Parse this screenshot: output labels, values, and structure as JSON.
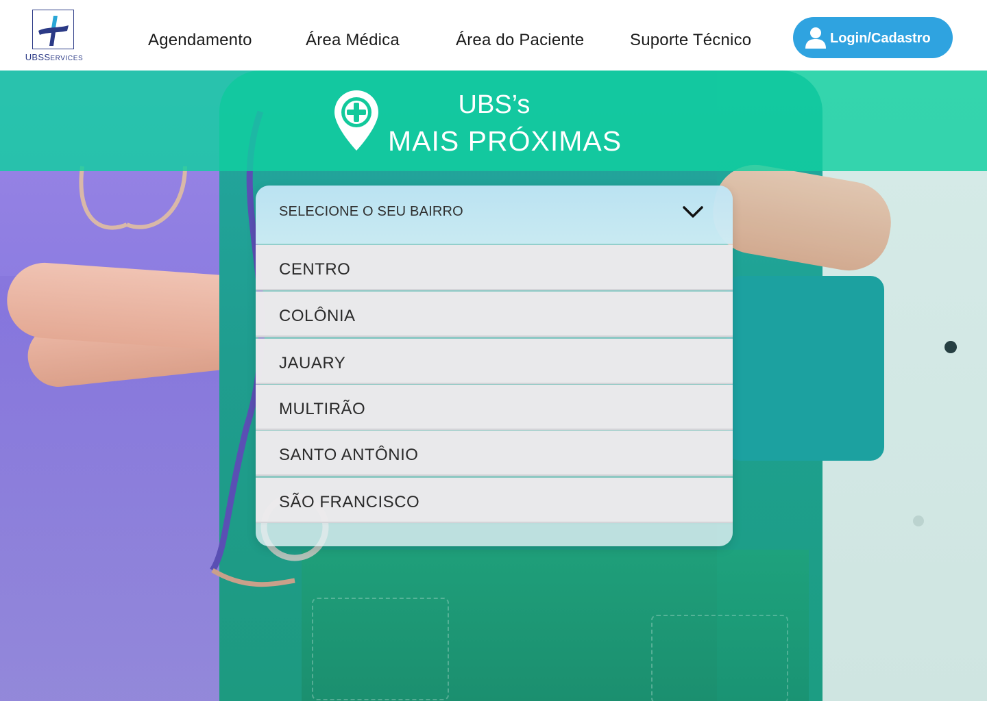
{
  "header": {
    "logo": {
      "text_main": "UBS",
      "text_suffix": "ERVICES",
      "text_s": "S"
    },
    "nav": [
      {
        "label": "Agendamento"
      },
      {
        "label": "Área Médica"
      },
      {
        "label": "Área do Paciente"
      },
      {
        "label": "Suporte Técnico"
      }
    ],
    "login": {
      "label": "Login/Cadastro",
      "icon": "user-icon"
    }
  },
  "banner": {
    "title_line1": "UBS’s",
    "title_line2": "MAIS PRÓXIMAS",
    "icon": "location-pin-plus-icon"
  },
  "dropdown": {
    "placeholder": "SELECIONE O SEU BAIRRO",
    "icon": "chevron-down-icon",
    "options": [
      {
        "label": "CENTRO"
      },
      {
        "label": "COLÔNIA"
      },
      {
        "label": "JAUARY"
      },
      {
        "label": "MULTIRÃO"
      },
      {
        "label": "SANTO ANTÔNIO"
      },
      {
        "label": "SÃO FRANCISCO"
      }
    ]
  },
  "colors": {
    "brand_navy": "#2b3a86",
    "login_blue": "#2fa3e0",
    "banner_green": "#10cfa0"
  }
}
